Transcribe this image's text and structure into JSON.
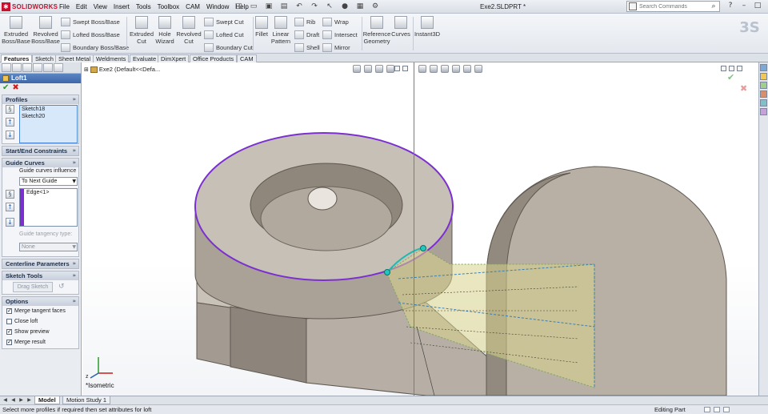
{
  "app": {
    "logo_text": "SOLIDWORKS",
    "doc_title": "Exe2.SLDPRT *"
  },
  "menu": [
    "File",
    "Edit",
    "View",
    "Insert",
    "Tools",
    "Toolbox",
    "CAM",
    "Window",
    "Help"
  ],
  "search": {
    "placeholder": "Search Commands"
  },
  "ribbon": {
    "extruded_boss": "Extruded Boss/Base",
    "revolved_boss": "Revolved Boss/Base",
    "swept_boss": "Swept Boss/Base",
    "lofted_boss": "Lofted Boss/Base",
    "boundary_boss": "Boundary Boss/Base",
    "extruded_cut": "Extruded Cut",
    "hole_wizard": "Hole Wizard",
    "revolved_cut": "Revolved Cut",
    "swept_cut": "Swept Cut",
    "lofted_cut": "Lofted Cut",
    "boundary_cut": "Boundary Cut",
    "fillet": "Fillet",
    "linear_pattern": "Linear Pattern",
    "rib": "Rib",
    "draft": "Draft",
    "shell": "Shell",
    "wrap": "Wrap",
    "intersect": "Intersect",
    "mirror": "Mirror",
    "reference_geometry": "Reference Geometry",
    "curves": "Curves",
    "instant3d": "Instant3D"
  },
  "tabs": [
    "Features",
    "Sketch",
    "Sheet Metal",
    "Weldments",
    "Evaluate",
    "DimXpert",
    "Office Products",
    "CAM"
  ],
  "property_manager": {
    "title": "Loft1",
    "profiles": {
      "heading": "Profiles",
      "items": [
        "Sketch18",
        "Sketch20"
      ]
    },
    "start_end": {
      "heading": "Start/End Constraints"
    },
    "guide_curves": {
      "heading": "Guide Curves",
      "influence_label": "Guide curves influence",
      "influence_value": "To Next Guide",
      "items": [
        "Edge<1>"
      ],
      "tangency_label": "Guide tangency type:",
      "tangency_value": "None"
    },
    "centerline": {
      "heading": "Centerline Parameters"
    },
    "sketch_tools": {
      "heading": "Sketch Tools",
      "drag_sketch": "Drag Sketch"
    },
    "options": {
      "heading": "Options",
      "merge_tangent": {
        "label": "Merge tangent faces",
        "checked": true
      },
      "close_loft": {
        "label": "Close loft",
        "checked": false
      },
      "show_preview": {
        "label": "Show preview",
        "checked": true
      },
      "merge_result": {
        "label": "Merge result",
        "checked": true
      }
    }
  },
  "viewport": {
    "tree_label": "Exe2  (Default<<Defa...",
    "view_label": "*Isometric"
  },
  "bottom_tabs": [
    "Model",
    "Motion Study 1"
  ],
  "status": {
    "message": "Select more profiles if required then set attributes for loft",
    "mode": "Editing Part"
  },
  "colors": {
    "accent": "#3d67a6",
    "selection": "#7b2fd0",
    "preview": "#c8c66a"
  }
}
